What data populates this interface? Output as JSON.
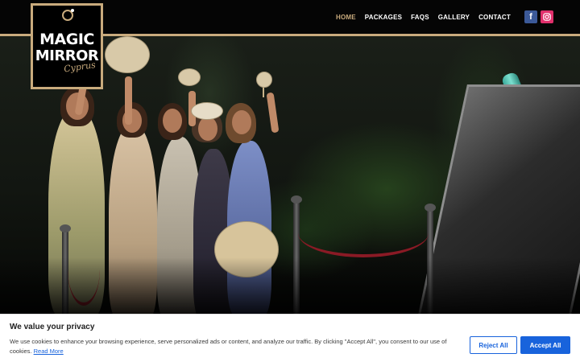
{
  "logo": {
    "line1": "MAGIC",
    "line2": "MIRROR",
    "subtitle": "Cyprus"
  },
  "nav": {
    "items": [
      {
        "label": "HOME",
        "active": true
      },
      {
        "label": "PACKAGES",
        "active": false
      },
      {
        "label": "FAQS",
        "active": false
      },
      {
        "label": "GALLERY",
        "active": false
      },
      {
        "label": "CONTACT",
        "active": false
      }
    ]
  },
  "social": {
    "facebook_glyph": "f",
    "icons": [
      "facebook-icon",
      "instagram-icon"
    ]
  },
  "colors": {
    "accent": "#c9ab7d",
    "cookie_primary": "#1863dc"
  },
  "cookie_banner": {
    "title": "We value your privacy",
    "text": "We use cookies to enhance your browsing experience, serve personalized ads or content, and analyze our traffic. By clicking \"Accept All\", you consent to our use of cookies.",
    "link_label": "Read More",
    "reject_label": "Reject All",
    "accept_label": "Accept All"
  }
}
